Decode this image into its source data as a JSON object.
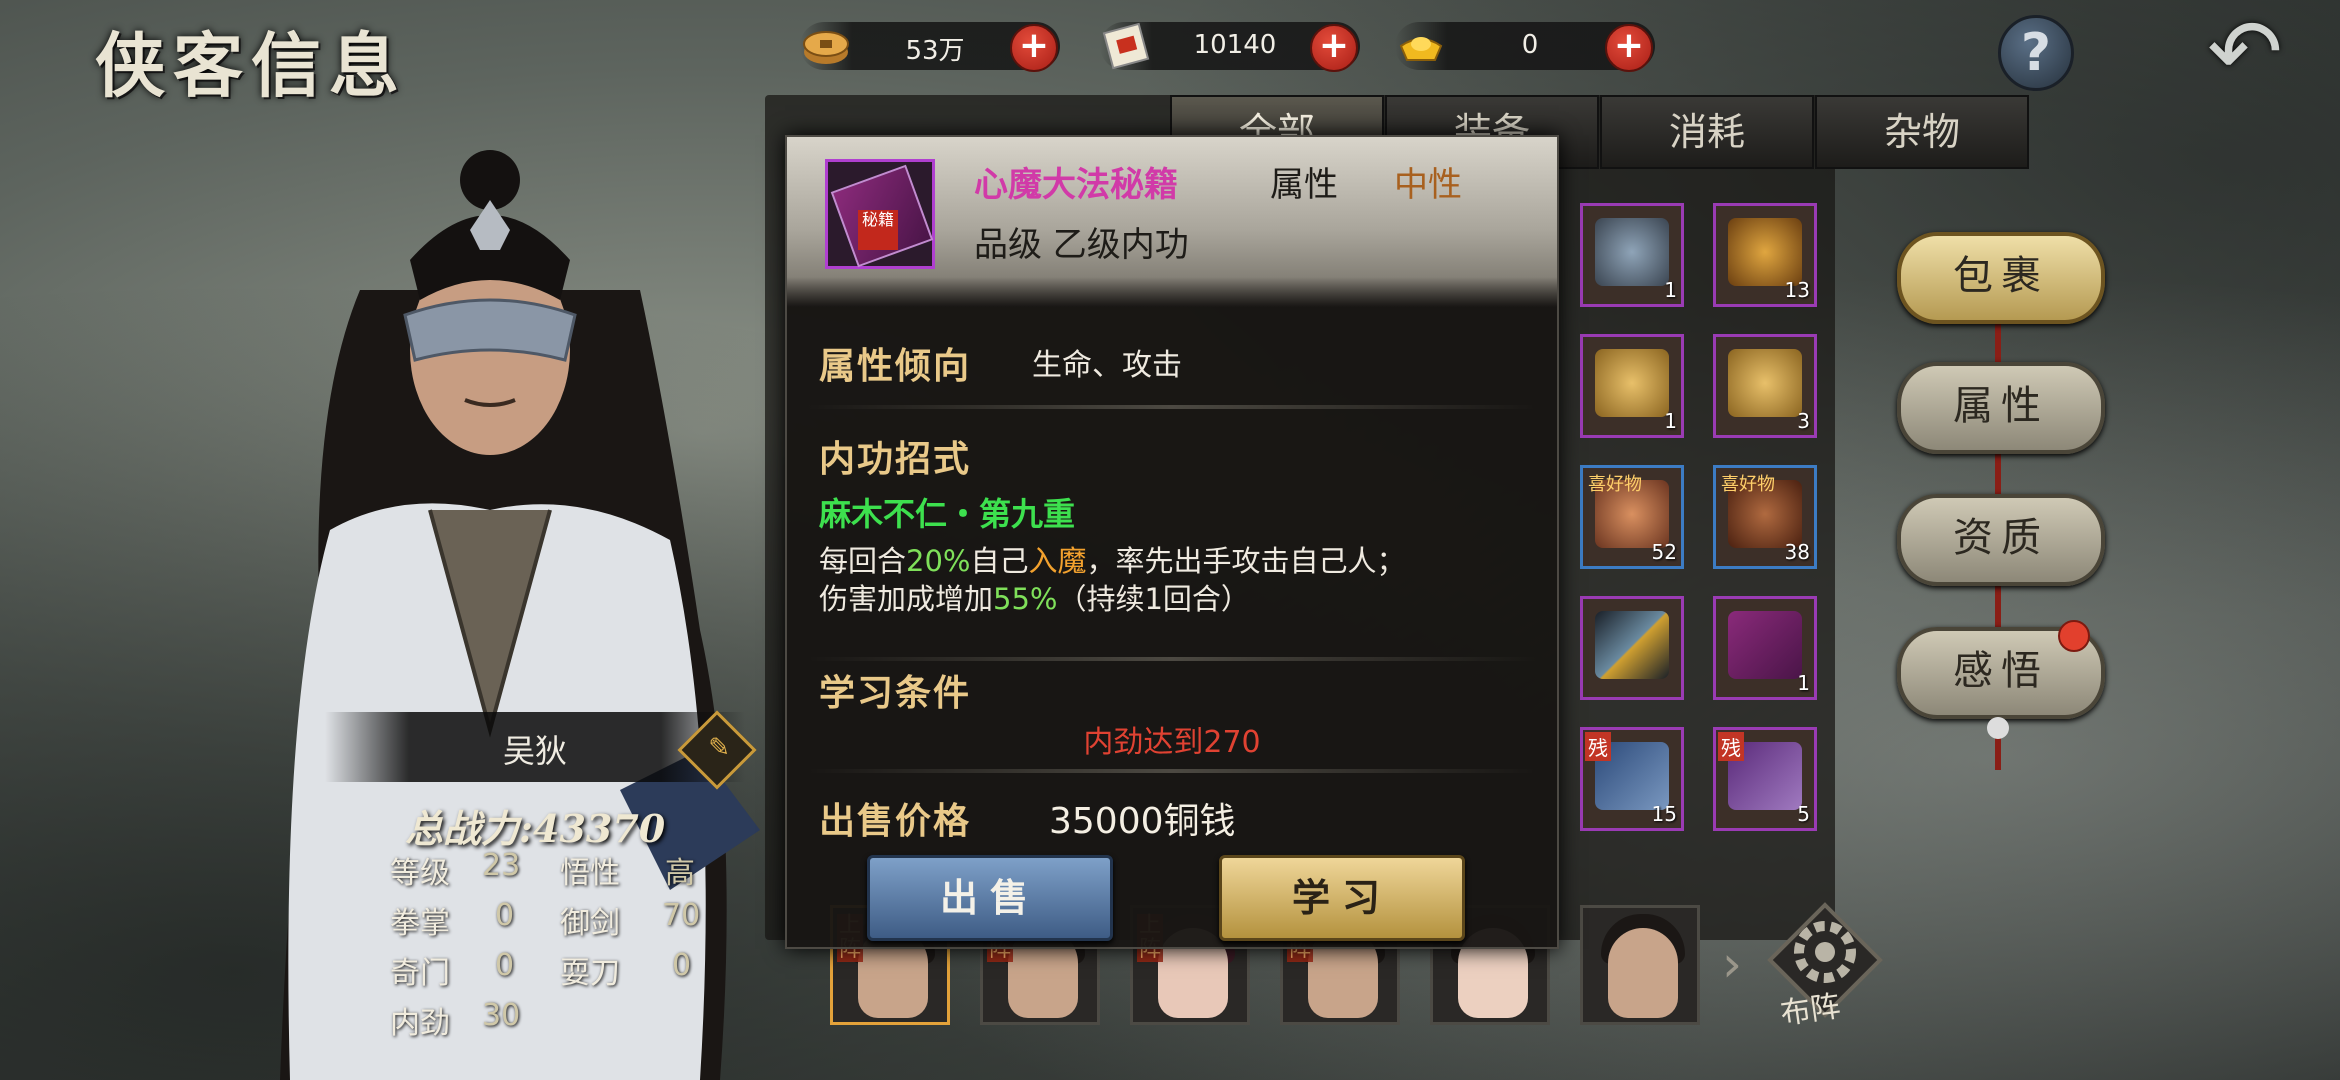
{
  "title": "侠客信息",
  "currency": [
    {
      "icon": "coin-icon",
      "value": "53万"
    },
    {
      "icon": "scroll-ticket-icon",
      "value": "10140"
    },
    {
      "icon": "gold-ingot-icon",
      "value": "0"
    }
  ],
  "character": {
    "name": "吴狄",
    "power_label": "总战力:43370",
    "stats": [
      {
        "label": "等级",
        "value": "23",
        "label2": "悟性",
        "value2": "高"
      },
      {
        "label": "拳掌",
        "value": "0",
        "label2": "御剑",
        "value2": "70"
      },
      {
        "label": "奇门",
        "value": "0",
        "label2": "耍刀",
        "value2": "0"
      },
      {
        "label": "内劲",
        "value": "30"
      }
    ]
  },
  "inventory": {
    "tabs": [
      "全部",
      "装备",
      "消耗",
      "杂物"
    ],
    "active_tab": "全部",
    "visible_slots": [
      {
        "count": "1"
      },
      {
        "count": "13"
      },
      {
        "count": "1"
      },
      {
        "count": "3"
      },
      {
        "tag": "喜好物",
        "count": "52"
      },
      {
        "tag": "喜好物",
        "count": "38"
      },
      {
        "count": ""
      },
      {
        "count": "1"
      },
      {
        "tag": "残",
        "count": "15"
      },
      {
        "tag": "残",
        "count": "5"
      }
    ]
  },
  "side_menu": [
    "包裹",
    "属性",
    "资质",
    "感悟"
  ],
  "active_menu": "包裹",
  "team": {
    "deploy_badge": "上阵",
    "formation_label": "布阵"
  },
  "popup": {
    "item_name": "心魔大法秘籍",
    "attr_label": "属性",
    "attr_value": "中性",
    "grade": "品级  乙级内功",
    "tendency_label": "属性倾向",
    "tendency_value": "生命、攻击",
    "skill_label": "内功招式",
    "skill_name": "麻木不仁・第九重",
    "desc_1a": "每回合",
    "desc_1b": "20%",
    "desc_1c": "自己",
    "desc_1d": "入魔",
    "desc_1e": "，率先出手攻击自己人；",
    "desc_2a": "伤害加成增加",
    "desc_2b": "55%",
    "desc_2c": "（持续1回合）",
    "req_label": "学习条件",
    "req_value": "内劲达到270",
    "price_label": "出售价格",
    "price_value": "35000铜钱",
    "sell_button": "出售",
    "learn_button": "学习",
    "seal_text": "秘籍"
  }
}
